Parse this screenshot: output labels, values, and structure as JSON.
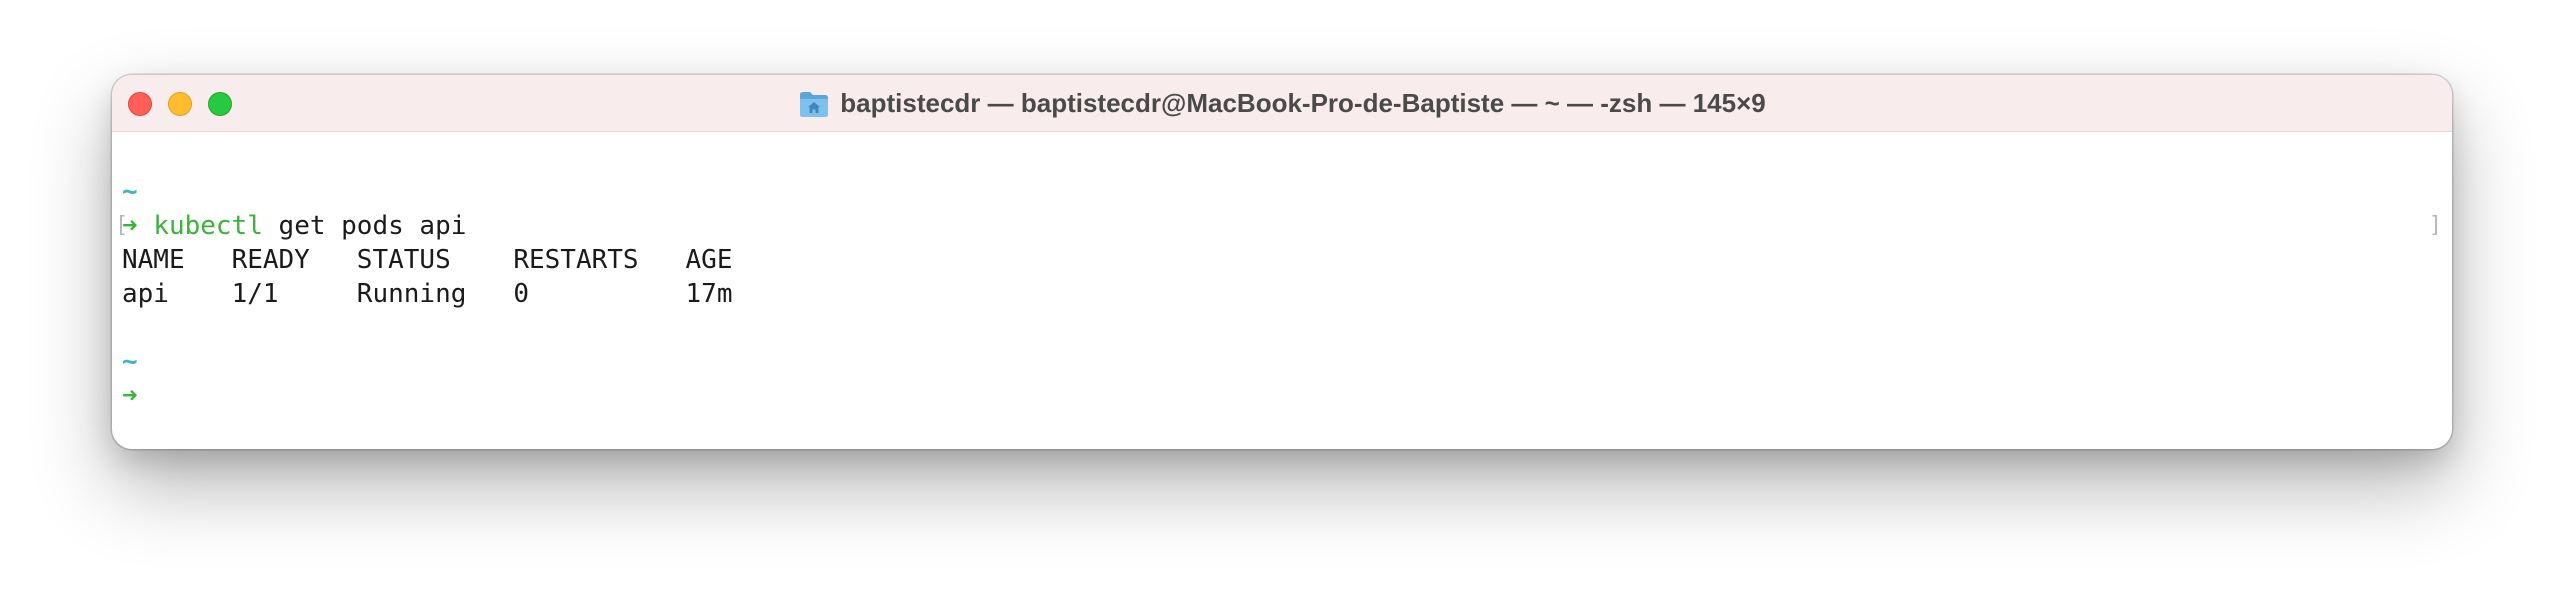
{
  "window": {
    "title": "baptistecdr — baptistecdr@MacBook-Pro-de-Baptiste — ~ — -zsh — 145×9",
    "traffic_lights": [
      "close",
      "minimize",
      "zoom"
    ],
    "folder_icon": "home-folder-icon"
  },
  "terminal": {
    "tilde": "~",
    "arrow": "➜",
    "command_name": "kubectl",
    "command_args": " get pods api",
    "mark_left": "[",
    "mark_right": "]",
    "table_header": "NAME   READY   STATUS    RESTARTS   AGE",
    "table_row": "api    1/1     Running   0          17m"
  },
  "colors": {
    "prompt_green": "#3bb33b",
    "tilde_cyan": "#3ab5c8",
    "titlebar_bg": "#f8ecec"
  }
}
